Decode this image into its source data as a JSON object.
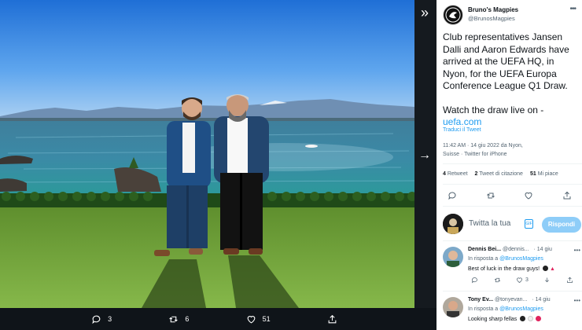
{
  "media_bar": {
    "replies": "3",
    "retweets": "6",
    "likes": "51"
  },
  "tweet": {
    "author_name": "Bruno's Magpies",
    "author_handle": "@BrunosMagpies",
    "text_part1": "Club representatives Jansen Dalli and Aaron Edwards have arrived at the UEFA HQ, in Nyon, for the UEFA Europa Conference League Q1 Draw.",
    "text_part2": "Watch the draw live on -",
    "link": "uefa.com",
    "translate": "Traduci il Tweet",
    "meta_line1": "11:42 AM · 14 giu 2022 da Nyon,",
    "meta_line2": "Suisse · Twitter for iPhone",
    "stats": {
      "retweets_count": "4",
      "retweets_label": "Retweet",
      "quotes_count": "2",
      "quotes_label": "Tweet di citazione",
      "likes_count": "51",
      "likes_label": "Mi piace"
    }
  },
  "reply_box": {
    "placeholder": "Twitta la tua",
    "button": "Rispondi"
  },
  "replies": [
    {
      "name": "Dennis Bei...",
      "handle": "@dennis...",
      "time": "· 14 giu",
      "reply_to_prefix": "In risposta a",
      "reply_to": "@BrunosMagpies",
      "text": "Best of luck in the draw guys!",
      "likes": "3"
    },
    {
      "name": "Tony Ev...",
      "handle": "@tonyevan...",
      "time": "· 14 giu",
      "reply_to_prefix": "In risposta a",
      "reply_to": "@BrunosMagpies",
      "text": "Looking sharp fellas"
    }
  ],
  "icons": {
    "collapse": "double-chevron-right-icon",
    "next": "arrow-right-icon",
    "reply": "reply-icon",
    "retweet": "retweet-icon",
    "like": "heart-icon",
    "share": "share-icon"
  },
  "colors": {
    "accent": "#1d9bf0",
    "reply_button": "#8ecdf8",
    "media_bar": "#0f1419"
  }
}
